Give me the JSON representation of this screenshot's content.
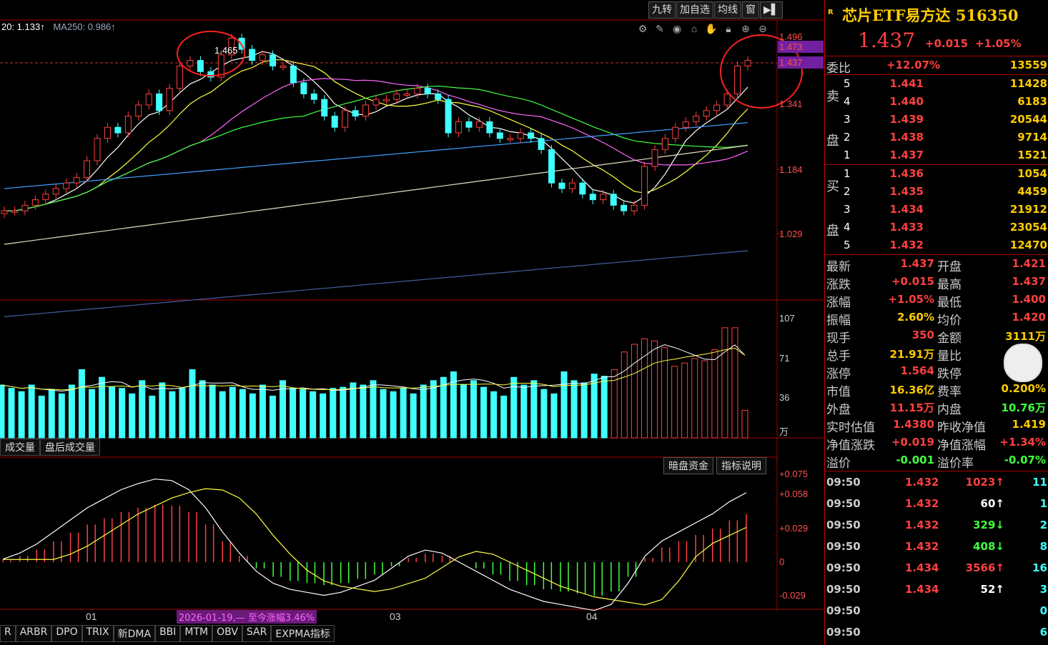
{
  "toolbar": {
    "b1": "九转",
    "b2": "加自选",
    "b3": "均线",
    "b4": "窗",
    "b5": "▶▌"
  },
  "ma_legend": {
    "ma20": "20: 1.133↑",
    "ma250": "MA250: 0.986↑"
  },
  "price_axis": [
    "1.496",
    "1.473",
    "1.437",
    "1.341",
    "1.184",
    "1.029"
  ],
  "vol_axis": [
    "107",
    "71",
    "36",
    "万"
  ],
  "macd_axis": [
    "+0.075",
    "+0.058",
    "+0.029",
    "0",
    "-0.029"
  ],
  "date_ticks": [
    "01",
    "03",
    "04"
  ],
  "peak_label": "1.465",
  "vol_tabs": [
    "成交量",
    "盘后成交量"
  ],
  "macd_btns": [
    "暗盘资金",
    "指标说明"
  ],
  "date_highlight": "2026-01-19,— 至今涨幅3.46%",
  "indicator_tabs": [
    "R",
    "ARBR",
    "DPO",
    "TRIX",
    "新DMA",
    "BBI",
    "MTM",
    "OBV",
    "SAR",
    "EXPMA指标"
  ],
  "panel": {
    "badge": "R",
    "name": "芯片ETF易方达 516350",
    "price": "1.437",
    "change": "+0.015",
    "change_pct": "+1.05%",
    "weibi_label": "委比",
    "weibi_pct": "+12.07%",
    "weibi_vol": "13559",
    "sell_label": "卖盘",
    "buy_label": "买盘",
    "asks": [
      {
        "l": "5",
        "p": "1.441",
        "v": "11428"
      },
      {
        "l": "4",
        "p": "1.440",
        "v": "6183"
      },
      {
        "l": "3",
        "p": "1.439",
        "v": "20544"
      },
      {
        "l": "2",
        "p": "1.438",
        "v": "9714"
      },
      {
        "l": "1",
        "p": "1.437",
        "v": "1521"
      }
    ],
    "bids": [
      {
        "l": "1",
        "p": "1.436",
        "v": "1054"
      },
      {
        "l": "2",
        "p": "1.435",
        "v": "4459"
      },
      {
        "l": "3",
        "p": "1.434",
        "v": "21912"
      },
      {
        "l": "4",
        "p": "1.433",
        "v": "23054"
      },
      {
        "l": "5",
        "p": "1.432",
        "v": "12470"
      }
    ],
    "stats": [
      {
        "k1": "最新",
        "v1": "1.437",
        "c1": "red",
        "k2": "开盘",
        "v2": "1.421",
        "c2": "red"
      },
      {
        "k1": "涨跌",
        "v1": "+0.015",
        "c1": "red",
        "k2": "最高",
        "v2": "1.437",
        "c2": "red"
      },
      {
        "k1": "涨幅",
        "v1": "+1.05%",
        "c1": "red",
        "k2": "最低",
        "v2": "1.400",
        "c2": "red"
      },
      {
        "k1": "振幅",
        "v1": "2.60%",
        "c1": "yel",
        "k2": "均价",
        "v2": "1.420",
        "c2": "red"
      },
      {
        "k1": "现手",
        "v1": "350",
        "c1": "red",
        "k2": "金额",
        "v2": "3111万",
        "c2": "yel"
      },
      {
        "k1": "总手",
        "v1": "21.91万",
        "c1": "yel",
        "k2": "量比",
        "v2": "",
        "c2": "yel"
      },
      {
        "k1": "涨停",
        "v1": "1.564",
        "c1": "red",
        "k2": "跌停",
        "v2": "",
        "c2": "grn"
      },
      {
        "k1": "市值",
        "v1": "16.36亿",
        "c1": "yel",
        "k2": "费率",
        "v2": "0.200%",
        "c2": "yel"
      },
      {
        "k1": "外盘",
        "v1": "11.15万",
        "c1": "red",
        "k2": "内盘",
        "v2": "10.76万",
        "c2": "grn"
      },
      {
        "k1": "实时估值",
        "v1": "1.4380",
        "c1": "red",
        "k2": "昨收净值",
        "v2": "1.419",
        "c2": "yel"
      },
      {
        "k1": "净值涨跌",
        "v1": "+0.019",
        "c1": "red",
        "k2": "净值涨幅",
        "v2": "+1.34%",
        "c2": "red"
      },
      {
        "k1": "溢价",
        "v1": "-0.001",
        "c1": "grn",
        "k2": "溢价率",
        "v2": "-0.07%",
        "c2": "grn"
      }
    ],
    "ticks": [
      {
        "t": "09:50",
        "p": "1.432",
        "pc": "red",
        "v": "1023",
        "vc": "red",
        "a": "↑",
        "n": "11"
      },
      {
        "t": "09:50",
        "p": "1.432",
        "pc": "red",
        "v": "60",
        "vc": "wht",
        "a": "↑",
        "n": "1"
      },
      {
        "t": "09:50",
        "p": "1.432",
        "pc": "red",
        "v": "329",
        "vc": "grn",
        "a": "↓",
        "n": "2"
      },
      {
        "t": "09:50",
        "p": "1.432",
        "pc": "red",
        "v": "408",
        "vc": "grn",
        "a": "↓",
        "n": "8"
      },
      {
        "t": "09:50",
        "p": "1.434",
        "pc": "red",
        "v": "3566",
        "vc": "red",
        "a": "↑",
        "n": "16"
      },
      {
        "t": "09:50",
        "p": "1.434",
        "pc": "red",
        "v": "52",
        "vc": "wht",
        "a": "↑",
        "n": "3"
      },
      {
        "t": "09:50",
        "p": "",
        "pc": "red",
        "v": "",
        "vc": "red",
        "a": "",
        "n": "0"
      },
      {
        "t": "09:50",
        "p": "",
        "pc": "red",
        "v": "",
        "vc": "red",
        "a": "",
        "n": "6"
      }
    ]
  },
  "chart_data": {
    "type": "bar",
    "candles_close_approx": [
      1.16,
      1.16,
      1.17,
      1.18,
      1.19,
      1.2,
      1.21,
      1.22,
      1.25,
      1.29,
      1.31,
      1.3,
      1.33,
      1.35,
      1.37,
      1.34,
      1.38,
      1.42,
      1.43,
      1.41,
      1.4,
      1.44,
      1.47,
      1.45,
      1.43,
      1.44,
      1.42,
      1.42,
      1.39,
      1.37,
      1.36,
      1.33,
      1.31,
      1.34,
      1.33,
      1.35,
      1.36,
      1.36,
      1.37,
      1.37,
      1.38,
      1.37,
      1.36,
      1.3,
      1.32,
      1.31,
      1.32,
      1.3,
      1.29,
      1.29,
      1.3,
      1.29,
      1.27,
      1.21,
      1.2,
      1.21,
      1.19,
      1.18,
      1.19,
      1.17,
      1.16,
      1.17,
      1.24,
      1.27,
      1.29,
      1.31,
      1.32,
      1.33,
      1.34,
      1.35,
      1.37,
      1.42,
      1.43
    ],
    "volume_wan_approx": [
      48,
      45,
      42,
      48,
      38,
      44,
      40,
      48,
      62,
      44,
      55,
      46,
      45,
      40,
      52,
      38,
      50,
      42,
      45,
      62,
      52,
      48,
      42,
      46,
      44,
      40,
      48,
      38,
      52,
      45,
      44,
      42,
      40,
      45,
      46,
      50,
      48,
      52,
      44,
      42,
      45,
      40,
      48,
      52,
      55,
      60,
      48,
      52,
      46,
      42,
      38,
      55,
      48,
      52,
      44,
      40,
      60,
      52,
      50,
      58,
      56,
      62,
      78,
      85,
      90,
      88,
      82,
      65,
      68,
      72,
      70,
      80,
      100,
      100,
      25
    ],
    "macd_approx": [
      0.002,
      0.006,
      0.012,
      0.02,
      0.028,
      0.036,
      0.042,
      0.048,
      0.052,
      0.055,
      0.054,
      0.048,
      0.036,
      0.02,
      0.006,
      -0.006,
      -0.014,
      -0.018,
      -0.02,
      -0.022,
      -0.02,
      -0.016,
      -0.012,
      -0.004,
      0.004,
      0.008,
      0.006,
      0.0,
      -0.006,
      -0.012,
      -0.018,
      -0.022,
      -0.026,
      -0.028,
      -0.03,
      -0.032,
      -0.028,
      -0.014,
      0.004,
      0.014,
      0.02,
      0.026,
      0.032,
      0.04,
      0.046
    ],
    "ylim": [
      1.0,
      1.5
    ]
  }
}
